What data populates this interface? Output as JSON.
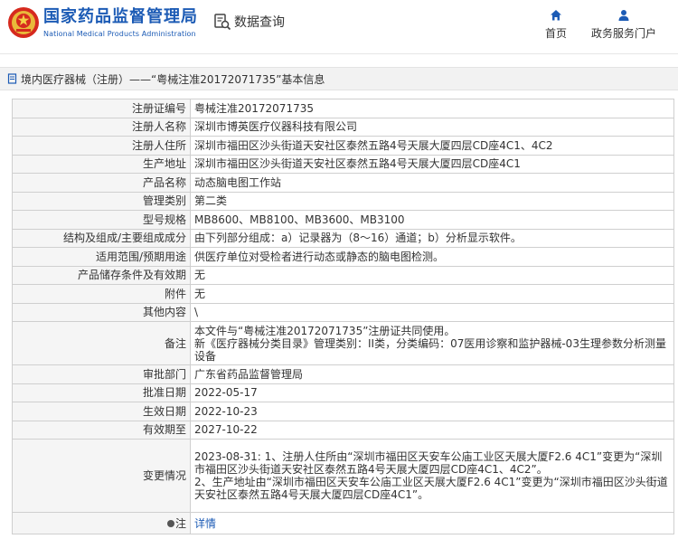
{
  "header": {
    "brand_cn": "国家药品监督管理局",
    "brand_en": "National Medical Products Administration",
    "query_label": "数据查询",
    "nav": {
      "home": "首页",
      "service": "政务服务门户"
    }
  },
  "breadcrumb": "境内医疗器械（注册）——“粤械注准20172071735”基本信息",
  "rows": [
    {
      "label": "注册证编号",
      "value": "粤械注准20172071735"
    },
    {
      "label": "注册人名称",
      "value": "深圳市博英医疗仪器科技有限公司"
    },
    {
      "label": "注册人住所",
      "value": "深圳市福田区沙头街道天安社区泰然五路4号天展大厦四层CD座4C1、4C2"
    },
    {
      "label": "生产地址",
      "value": "深圳市福田区沙头街道天安社区泰然五路4号天展大厦四层CD座4C1"
    },
    {
      "label": "产品名称",
      "value": "动态脑电图工作站"
    },
    {
      "label": "管理类别",
      "value": "第二类"
    },
    {
      "label": "型号规格",
      "value": "MB8600、MB8100、MB3600、MB3100"
    },
    {
      "label": "结构及组成/主要组成成分",
      "value": "由下列部分组成：a）记录器为（8～16）通道；b）分析显示软件。"
    },
    {
      "label": "适用范围/预期用途",
      "value": "供医疗单位对受检者进行动态或静态的脑电图检测。"
    },
    {
      "label": "产品储存条件及有效期",
      "value": "无"
    },
    {
      "label": "附件",
      "value": "无"
    },
    {
      "label": "其他内容",
      "value": "\\"
    },
    {
      "label": "备注",
      "value": "本文件与“粤械注准20172071735”注册证共同使用。",
      "value2": "新《医疗器械分类目录》管理类别：II类，分类编码：07医用诊察和监护器械-03生理参数分析测量设备"
    },
    {
      "label": "审批部门",
      "value": "广东省药品监督管理局"
    },
    {
      "label": "批准日期",
      "value": "2022-05-17"
    },
    {
      "label": "生效日期",
      "value": "2022-10-23"
    },
    {
      "label": "有效期至",
      "value": "2027-10-22"
    },
    {
      "label": "变更情况",
      "value": "2023-08-31: 1、注册人住所由“深圳市福田区天安车公庙工业区天展大厦F2.6 4C1”变更为“深圳市福田区沙头街道天安社区泰然五路4号天展大厦四层CD座4C1、4C2”。",
      "value2": "2、生产地址由“深圳市福田区天安车公庙工业区天展大厦F2.6 4C1”变更为“深圳市福田区沙头街道天安社区泰然五路4号天展大厦四层CD座4C1”。"
    }
  ],
  "footer_row": {
    "label": "注",
    "link": "详情"
  },
  "colors": {
    "brand": "#1c5bb5",
    "link": "#1c5bb5"
  }
}
